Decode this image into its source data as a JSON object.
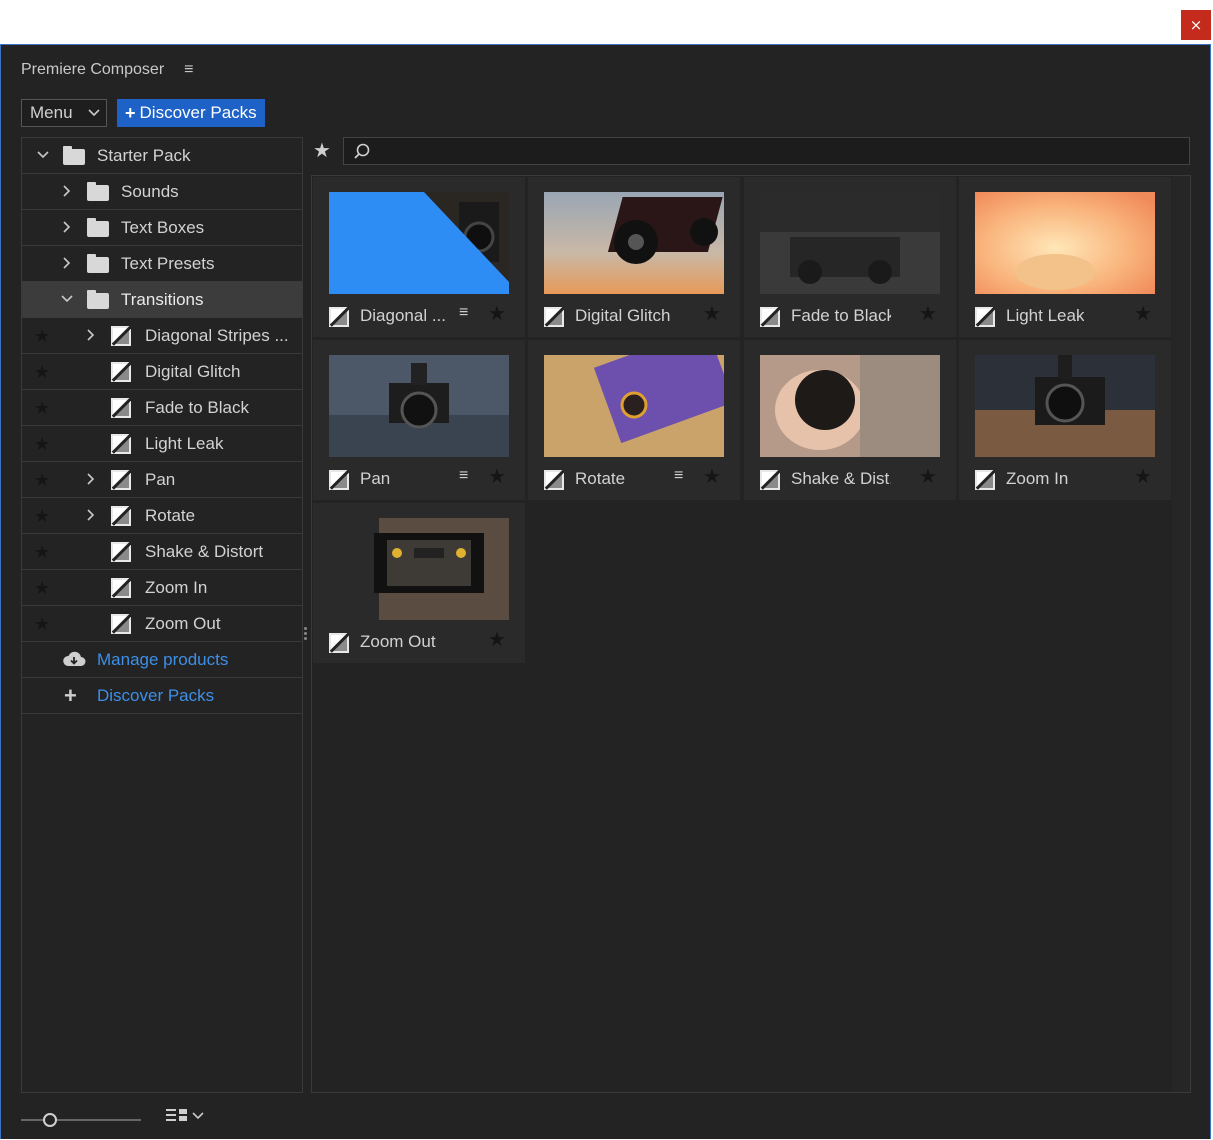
{
  "window": {
    "close_label": "×"
  },
  "panel": {
    "title": "Premiere Composer",
    "menu_icon": "≡"
  },
  "toolbar": {
    "menu_label": "Menu",
    "discover_label": "Discover Packs"
  },
  "tree": {
    "root": "Starter Pack",
    "folders": [
      "Sounds",
      "Text Boxes",
      "Text Presets"
    ],
    "selected_folder": "Transitions",
    "items": [
      {
        "label": "Diagonal Stripes ...",
        "has_children": true
      },
      {
        "label": "Digital Glitch",
        "has_children": false
      },
      {
        "label": "Fade to Black",
        "has_children": false
      },
      {
        "label": "Light Leak",
        "has_children": false
      },
      {
        "label": "Pan",
        "has_children": true
      },
      {
        "label": "Rotate",
        "has_children": true
      },
      {
        "label": "Shake & Distort",
        "has_children": false
      },
      {
        "label": "Zoom In",
        "has_children": false
      },
      {
        "label": "Zoom Out",
        "has_children": false
      }
    ],
    "manage_label": "Manage products",
    "discover_label": "Discover Packs"
  },
  "search": {
    "placeholder": "",
    "value": ""
  },
  "grid": {
    "cards": [
      {
        "name": "Diagonal ...",
        "has_list": true
      },
      {
        "name": "Digital Glitch",
        "has_list": false
      },
      {
        "name": "Fade to Black",
        "has_list": false
      },
      {
        "name": "Light Leak",
        "has_list": false
      },
      {
        "name": "Pan",
        "has_list": true
      },
      {
        "name": "Rotate",
        "has_list": true
      },
      {
        "name": "Shake & Dist...",
        "has_list": false
      },
      {
        "name": "Zoom In",
        "has_list": false
      },
      {
        "name": "Zoom Out",
        "has_list": false
      }
    ]
  },
  "colors": {
    "accent": "#1e62c8",
    "link": "#3d8fe8",
    "panel_bg": "#232323",
    "close": "#c42b1c"
  }
}
